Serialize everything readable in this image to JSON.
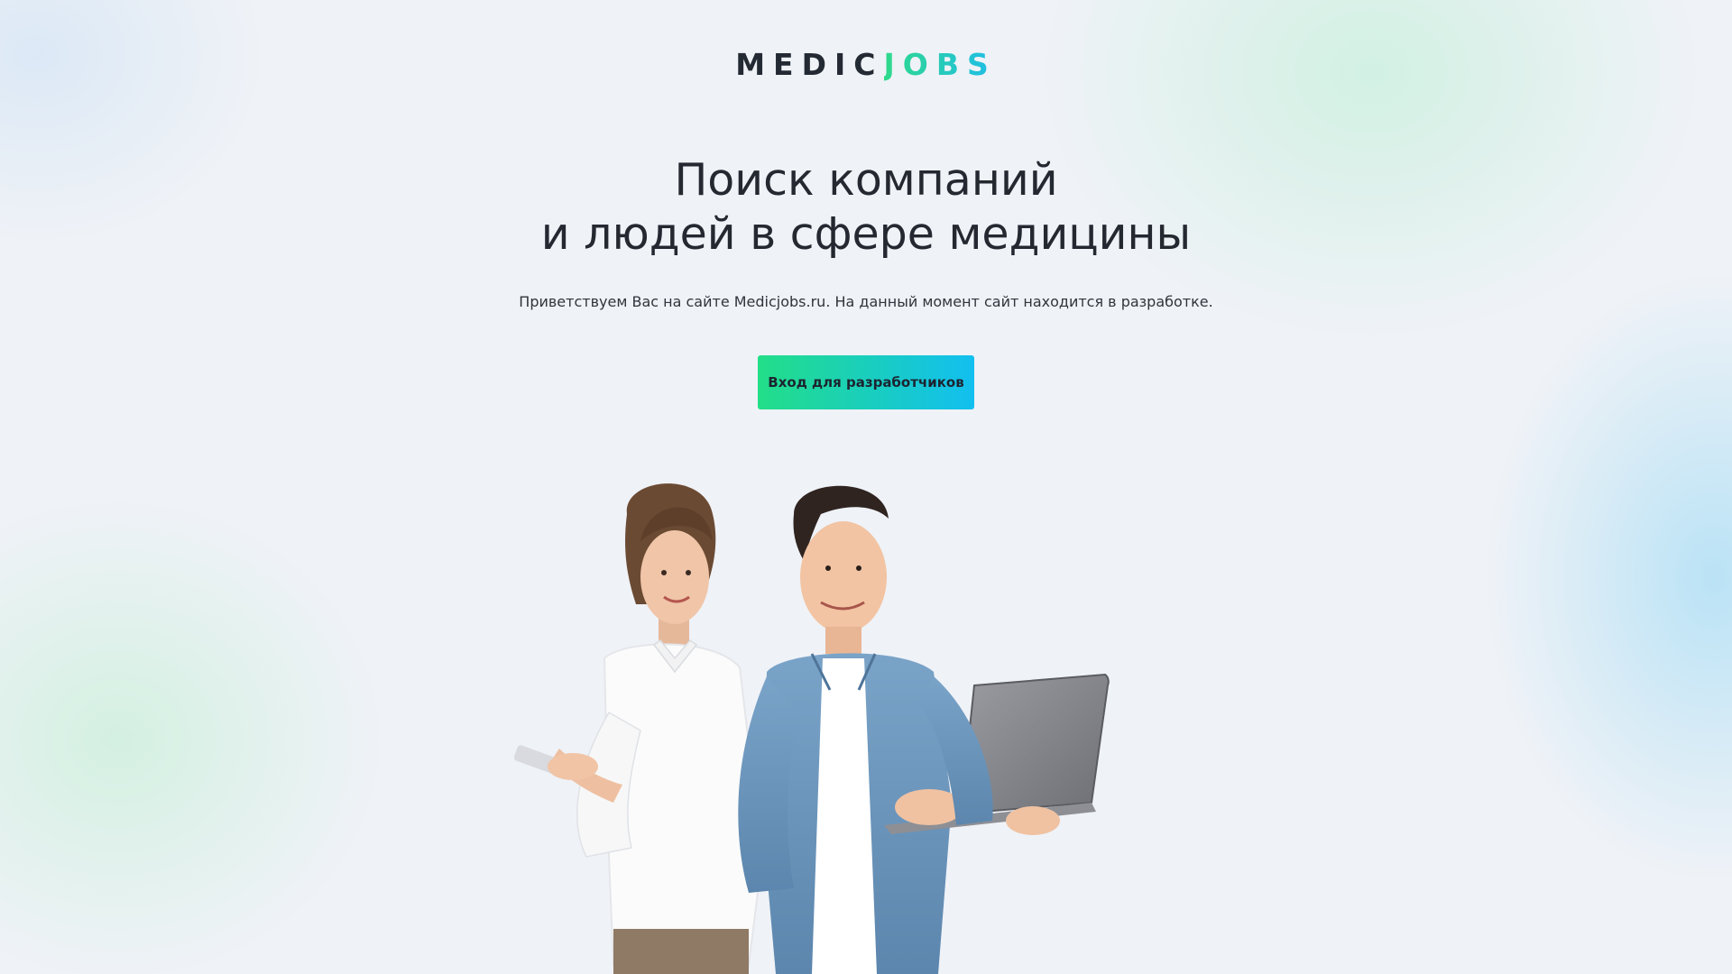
{
  "logo": {
    "part1": "MEDIC",
    "part2": "JOBS"
  },
  "hero": {
    "title_line1": "Поиск компаний",
    "title_line2": "и людей в сфере медицины",
    "subtitle": "Приветствуем Вас на сайте Medicjobs.ru. На данный момент сайт находится в разработке."
  },
  "cta": {
    "label": "Вход для разработчиков"
  },
  "colors": {
    "accent_start": "#22de88",
    "accent_end": "#12bff0",
    "text_dark": "#242830",
    "background": "#eff2f7"
  }
}
